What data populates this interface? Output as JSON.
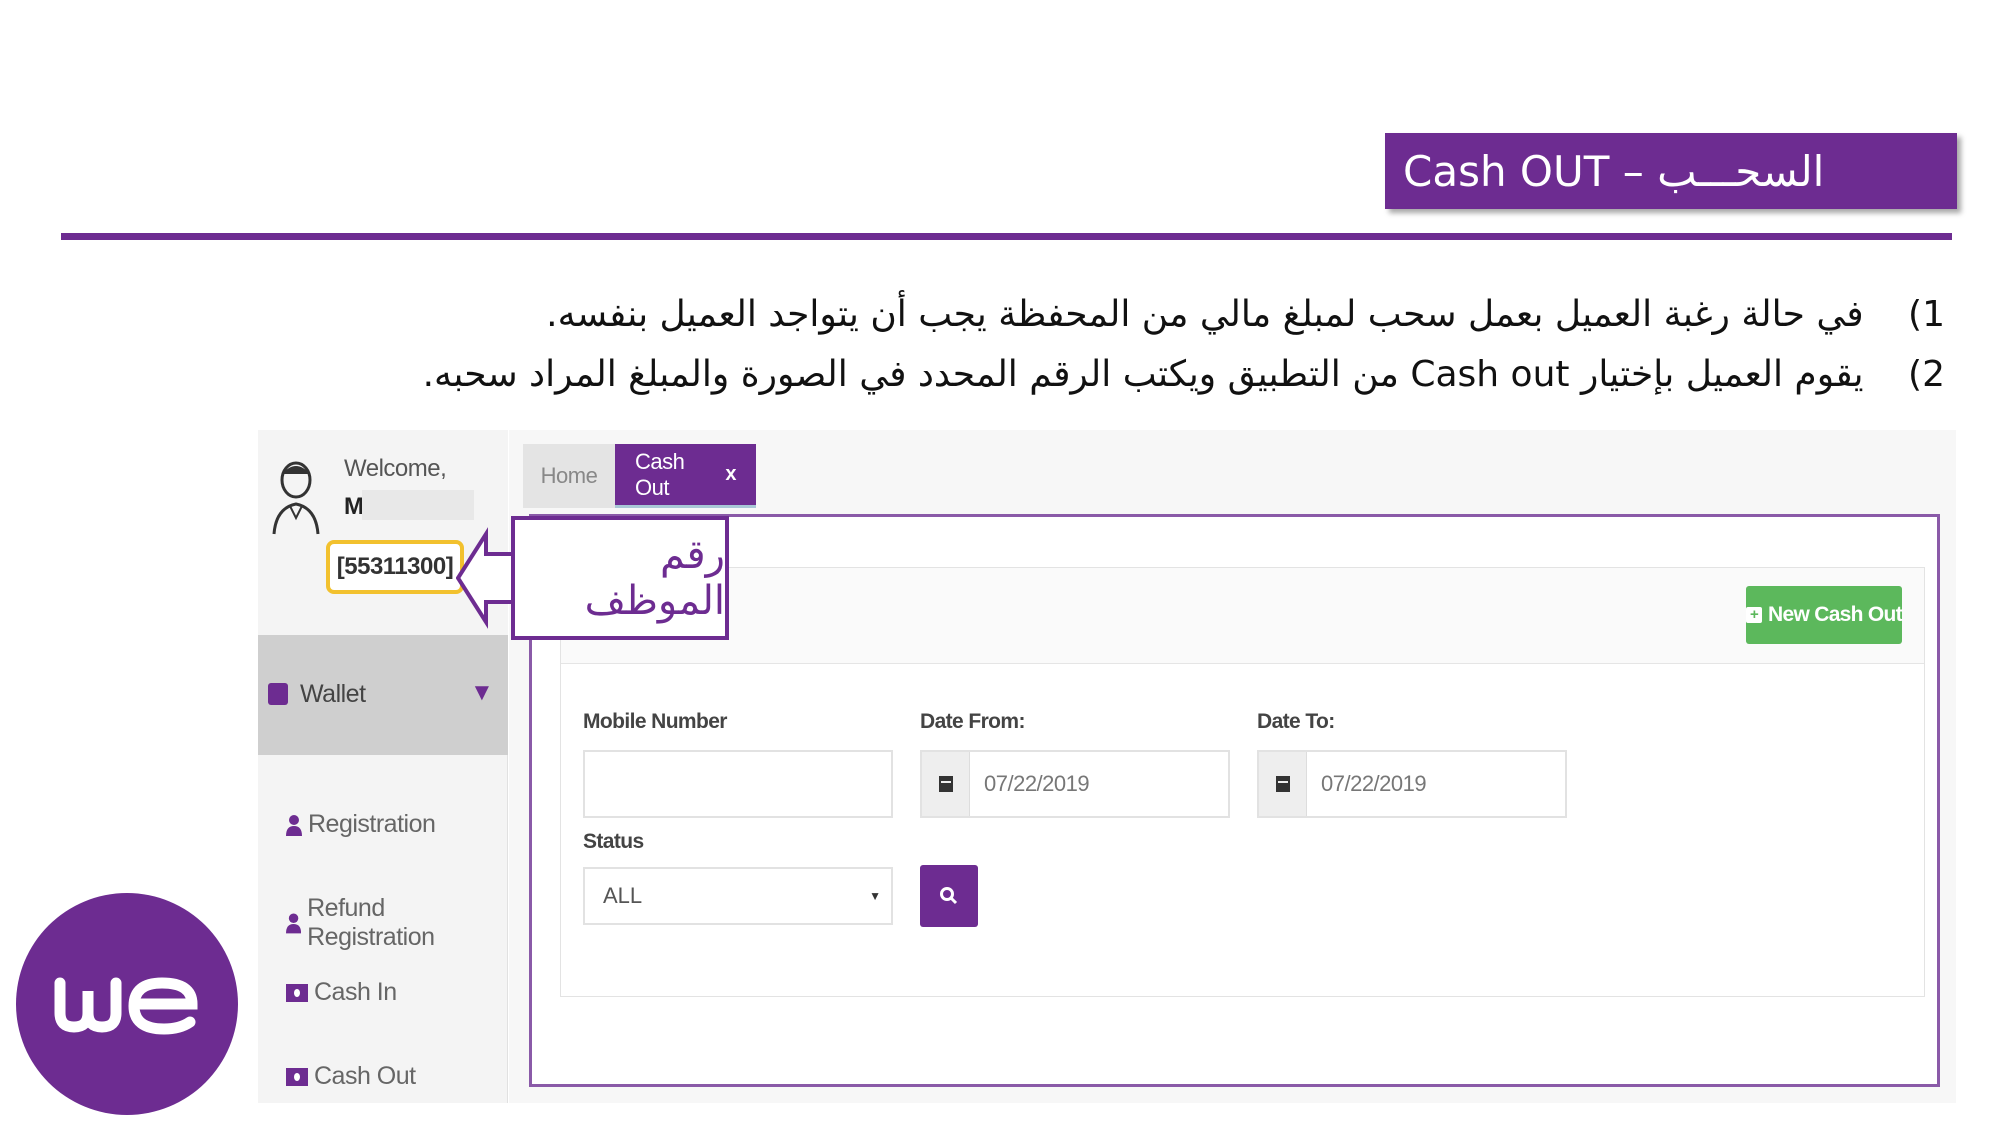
{
  "header": {
    "title": "Cash OUT – السحـــب"
  },
  "instructions": [
    {
      "num": "1)",
      "text": "في حالة رغبة العميل بعمل سحب لمبلغ مالي من المحفظة يجب أن يتواجد العميل بنفسه."
    },
    {
      "num": "2)",
      "text": "يقوم العميل بإختيار Cash out من التطبيق ويكتب الرقم المحدد في الصورة والمبلغ المراد سحبه."
    }
  ],
  "app": {
    "user": {
      "welcome": "Welcome,",
      "name_initial": "M",
      "employee_id": "[55311300]"
    },
    "sidebar": {
      "wallet_label": "Wallet",
      "items": [
        {
          "label": "Registration",
          "icon": "user-icon"
        },
        {
          "label": "Refund Registration",
          "icon": "user-icon"
        },
        {
          "label": "Cash In",
          "icon": "money-icon"
        },
        {
          "label": "Cash Out",
          "icon": "money-icon"
        }
      ]
    },
    "tabs": {
      "home": "Home",
      "cash_out": "Cash Out",
      "close": "x"
    },
    "form": {
      "new_button": "New Cash Out",
      "mobile_label": "Mobile Number",
      "mobile_value": "",
      "date_from_label": "Date From:",
      "date_from_value": "07/22/2019",
      "date_to_label": "Date To:",
      "date_to_value": "07/22/2019",
      "status_label": "Status",
      "status_value": "ALL"
    }
  },
  "callout": {
    "text": "رقم الموظف"
  },
  "colors": {
    "brand": "#6d2c91",
    "callout_border": "#f2c12e",
    "button_green": "#5cb85c"
  },
  "logo": {
    "text": "we"
  }
}
